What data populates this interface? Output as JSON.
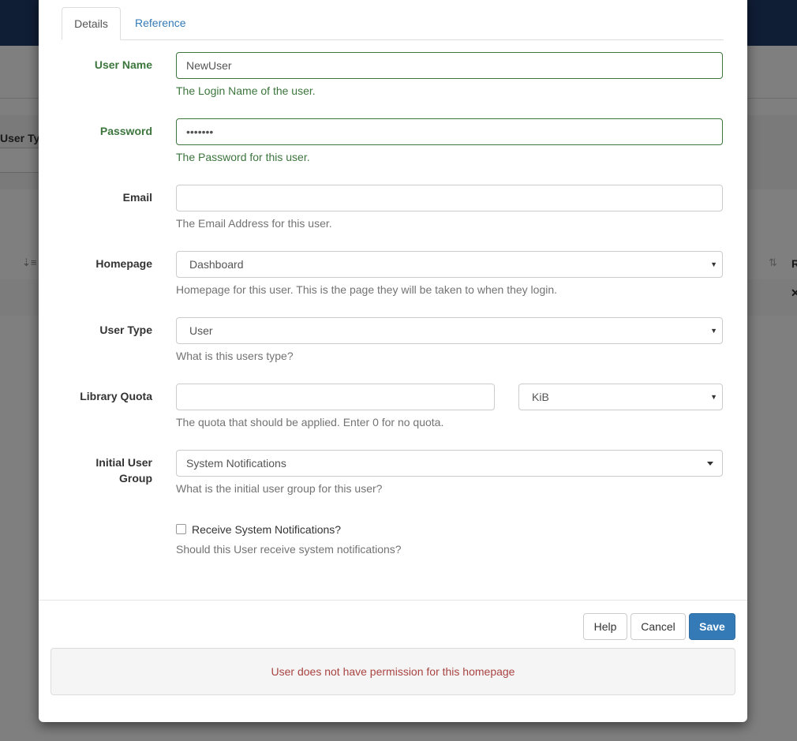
{
  "background": {
    "filter_label": "User Ty",
    "right_col_label": "R",
    "sort_icon": "sort-amount-icon",
    "row_action_icon": "close-icon"
  },
  "tabs": [
    {
      "label": "Details",
      "active": true
    },
    {
      "label": "Reference",
      "active": false
    }
  ],
  "form": {
    "username": {
      "label": "User Name",
      "value": "NewUser",
      "help": "The Login Name of the user."
    },
    "password": {
      "label": "Password",
      "value": "•••••••",
      "help": "The Password for this user."
    },
    "email": {
      "label": "Email",
      "value": "",
      "help": "The Email Address for this user."
    },
    "homepage": {
      "label": "Homepage",
      "value": "Dashboard",
      "help": "Homepage for this user. This is the page they will be taken to when they login."
    },
    "user_type": {
      "label": "User Type",
      "value": "User",
      "help": "What is this users type?"
    },
    "library_quota": {
      "label": "Library Quota",
      "value": "",
      "unit": "KiB",
      "help": "The quota that should be applied. Enter 0 for no quota."
    },
    "initial_group": {
      "label_line1": "Initial User",
      "label_line2": "Group",
      "value": "System Notifications",
      "help": "What is the initial user group for this user?"
    },
    "notifications": {
      "label": "Receive System Notifications?",
      "checked": false,
      "help": "Should this User receive system notifications?"
    }
  },
  "buttons": {
    "help": "Help",
    "cancel": "Cancel",
    "save": "Save"
  },
  "alert": "User does not have permission for this homepage",
  "colors": {
    "success": "#3c763d",
    "primary": "#337ab7",
    "error": "#a94442",
    "header": "#1f3a6b"
  }
}
